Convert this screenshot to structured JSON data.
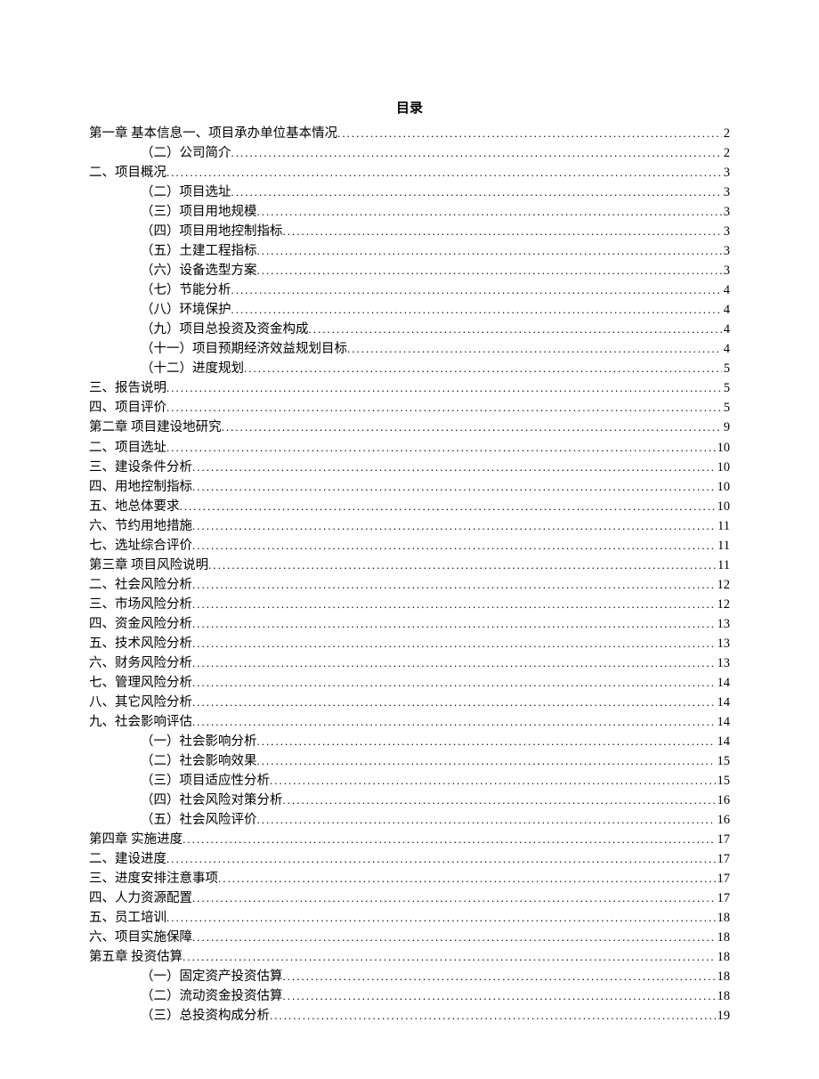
{
  "title": "目录",
  "entries": [
    {
      "level": 1,
      "label": "第一章 基本信息一、项目承办单位基本情况",
      "page": "2"
    },
    {
      "level": 2,
      "label": "（二）公司简介",
      "page": "2"
    },
    {
      "level": 1,
      "label": "二、项目概况",
      "page": "3"
    },
    {
      "level": 2,
      "label": "（二）项目选址",
      "page": "3"
    },
    {
      "level": 2,
      "label": "（三）项目用地规模",
      "page": "3"
    },
    {
      "level": 2,
      "label": "（四）项目用地控制指标",
      "page": "3"
    },
    {
      "level": 2,
      "label": "（五）土建工程指标",
      "page": "3"
    },
    {
      "level": 2,
      "label": "（六）设备选型方案",
      "page": "3"
    },
    {
      "level": 2,
      "label": "（七）节能分析",
      "page": "4"
    },
    {
      "level": 2,
      "label": "（八）环境保护",
      "page": "4"
    },
    {
      "level": 2,
      "label": "（九）项目总投资及资金构成",
      "page": "4"
    },
    {
      "level": 2,
      "label": "（十一）项目预期经济效益规划目标",
      "page": "4"
    },
    {
      "level": 2,
      "label": "（十二）进度规划",
      "page": "5"
    },
    {
      "level": 1,
      "label": "三、报告说明",
      "page": "5"
    },
    {
      "level": 1,
      "label": "四、项目评价",
      "page": "5"
    },
    {
      "level": 1,
      "label": "第二章 项目建设地研究",
      "page": "9"
    },
    {
      "level": 1,
      "label": "二、项目选址",
      "page": "10"
    },
    {
      "level": 1,
      "label": "三、建设条件分析",
      "page": "10"
    },
    {
      "level": 1,
      "label": "四、用地控制指标",
      "page": "10"
    },
    {
      "level": 1,
      "label": "五、地总体要求",
      "page": "10"
    },
    {
      "level": 1,
      "label": "六、节约用地措施",
      "page": "11"
    },
    {
      "level": 1,
      "label": "七、选址综合评价",
      "page": "11"
    },
    {
      "level": 1,
      "label": "第三章 项目风险说明",
      "page": "11"
    },
    {
      "level": 1,
      "label": "二、社会风险分析",
      "page": "12"
    },
    {
      "level": 1,
      "label": "三、市场风险分析",
      "page": "12"
    },
    {
      "level": 1,
      "label": "四、资金风险分析",
      "page": "13"
    },
    {
      "level": 1,
      "label": "五、技术风险分析",
      "page": "13"
    },
    {
      "level": 1,
      "label": "六、财务风险分析",
      "page": "13"
    },
    {
      "level": 1,
      "label": "七、管理风险分析",
      "page": "14"
    },
    {
      "level": 1,
      "label": "八、其它风险分析",
      "page": "14"
    },
    {
      "level": 1,
      "label": "九、社会影响评估",
      "page": "14"
    },
    {
      "level": 2,
      "label": "（一）社会影响分析",
      "page": "14"
    },
    {
      "level": 2,
      "label": "（二）社会影响效果",
      "page": "15"
    },
    {
      "level": 2,
      "label": "（三）项目适应性分析",
      "page": "15"
    },
    {
      "level": 2,
      "label": "（四）社会风险对策分析",
      "page": "16"
    },
    {
      "level": 2,
      "label": "（五）社会风险评价",
      "page": "16"
    },
    {
      "level": 1,
      "label": "第四章 实施进度",
      "page": "17"
    },
    {
      "level": 1,
      "label": "二、建设进度",
      "page": "17"
    },
    {
      "level": 1,
      "label": "三、进度安排注意事项",
      "page": "17"
    },
    {
      "level": 1,
      "label": "四、人力资源配置",
      "page": "17"
    },
    {
      "level": 1,
      "label": "五、员工培训",
      "page": "18"
    },
    {
      "level": 1,
      "label": "六、项目实施保障",
      "page": "18"
    },
    {
      "level": 1,
      "label": "第五章 投资估算",
      "page": "18"
    },
    {
      "level": 2,
      "label": "（一）固定资产投资估算",
      "page": "18"
    },
    {
      "level": 2,
      "label": "（二）流动资金投资估算",
      "page": "18"
    },
    {
      "level": 2,
      "label": "（三）总投资构成分析",
      "page": "19"
    }
  ]
}
